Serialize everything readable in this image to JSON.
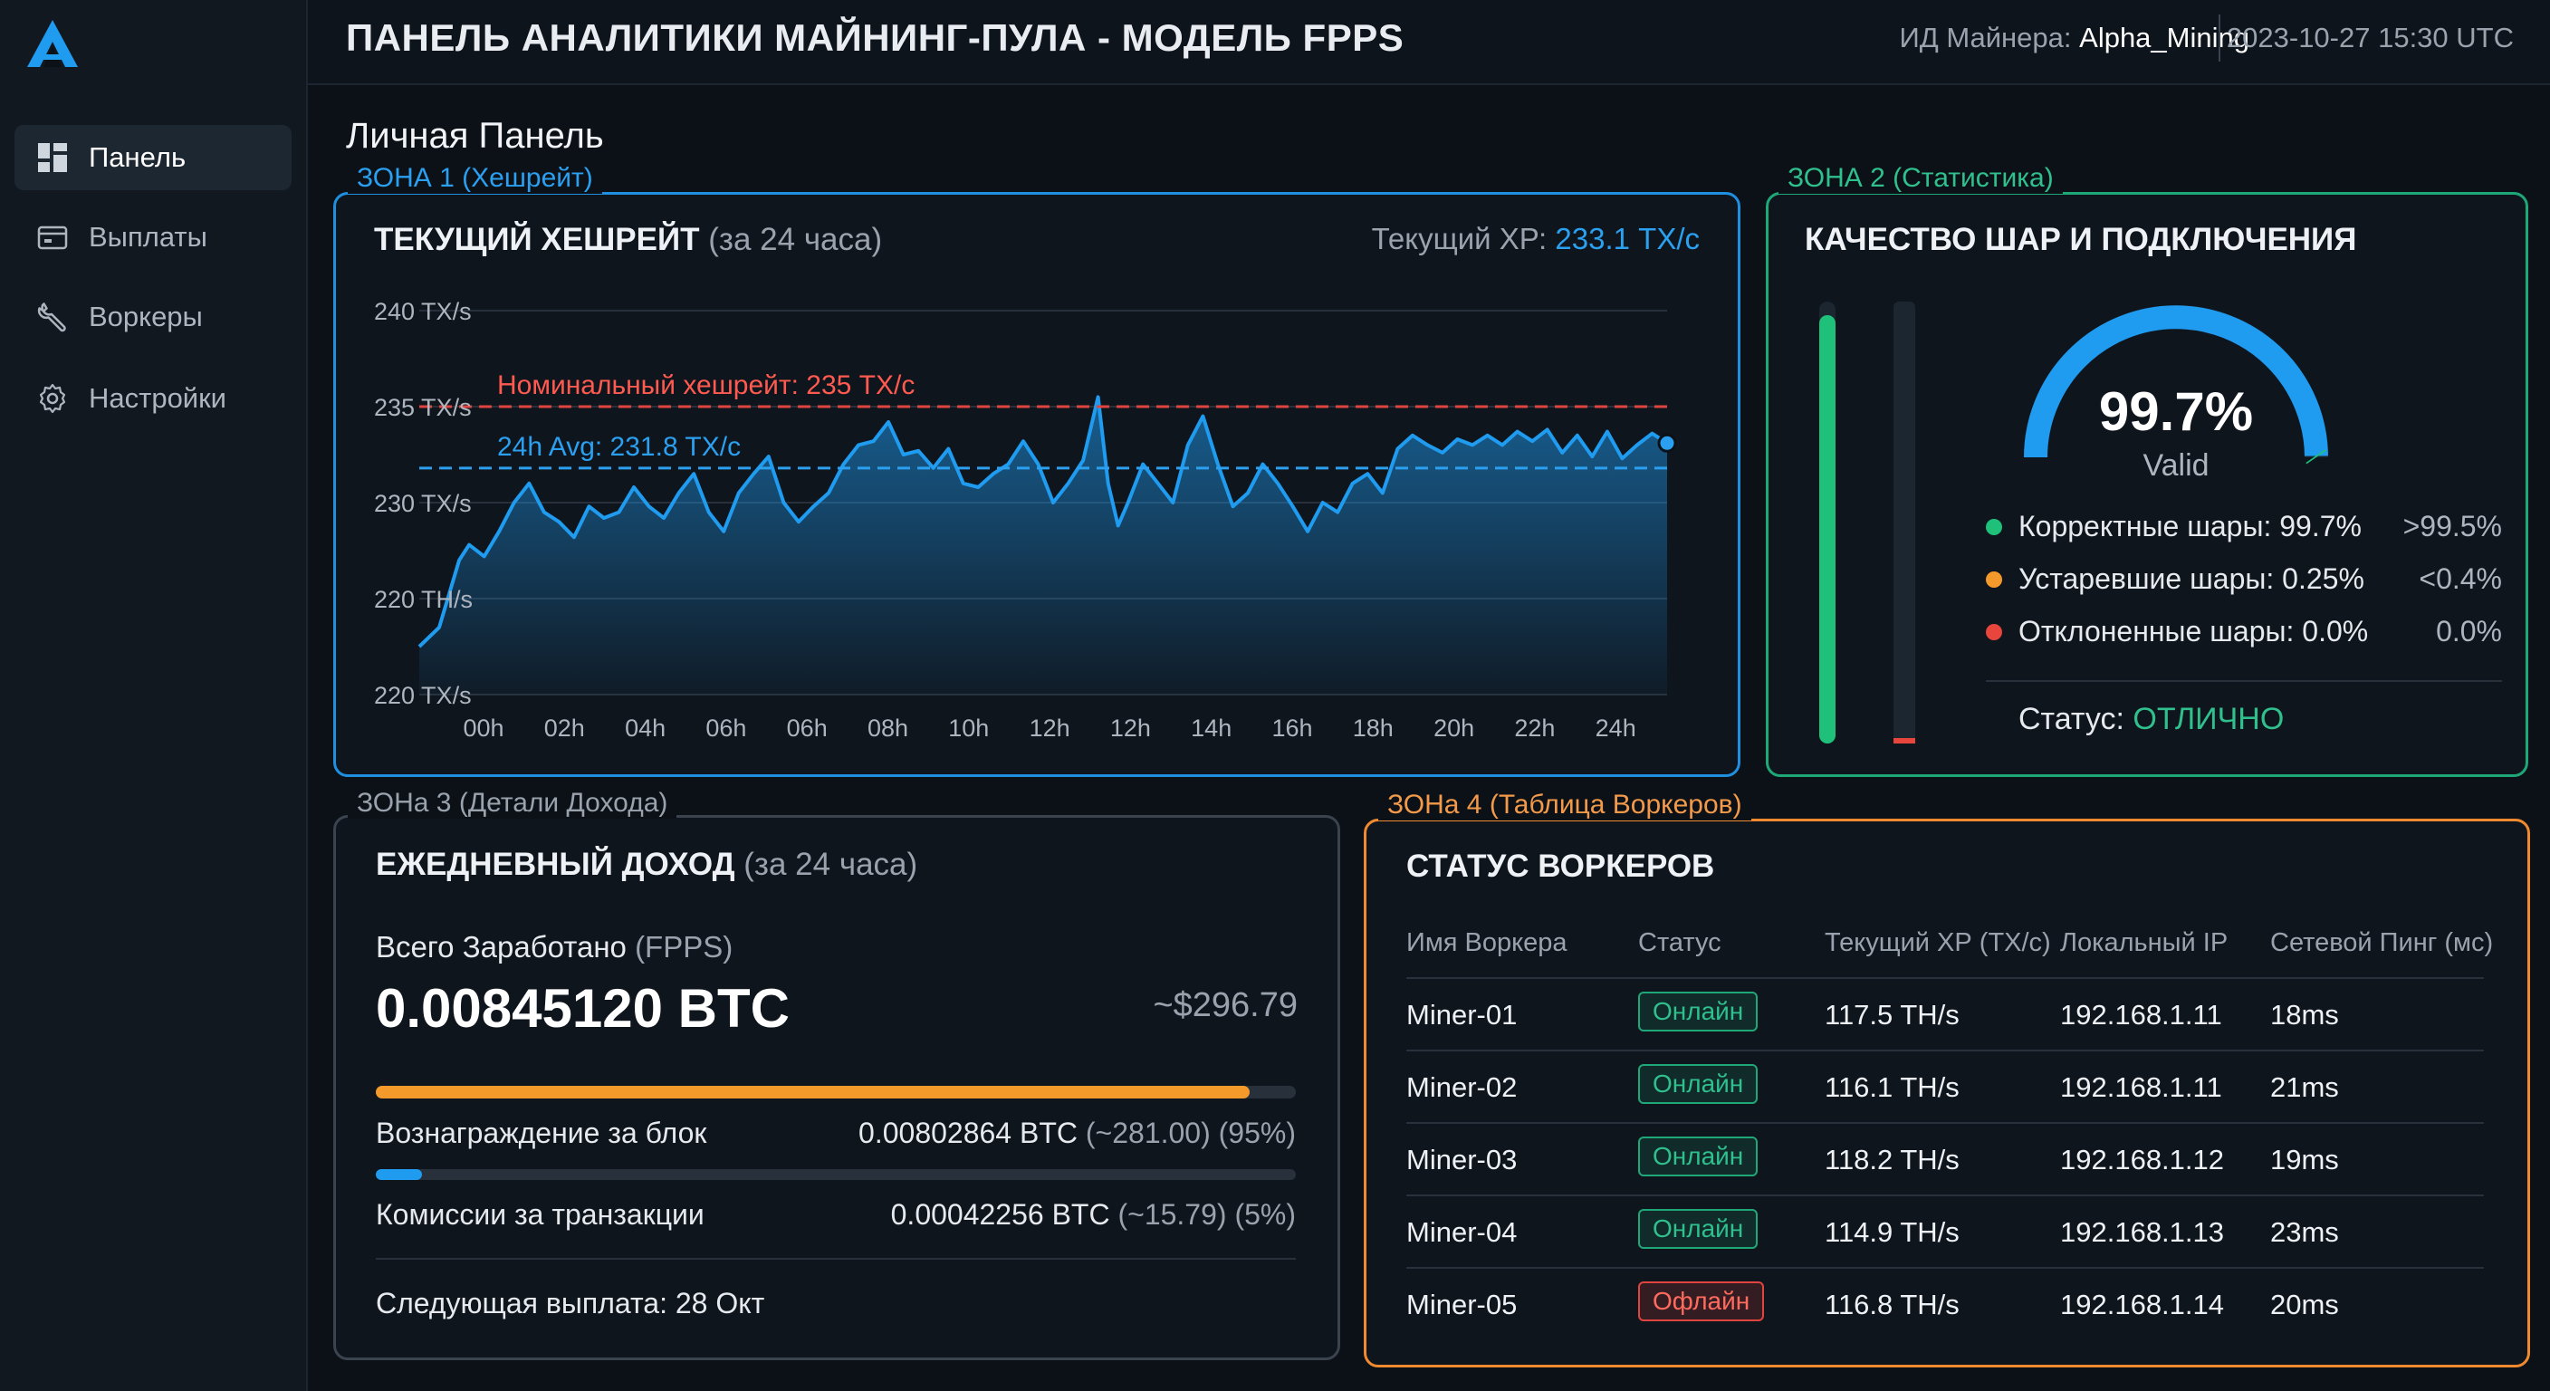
{
  "header": {
    "title": "ПАНЕЛЬ АНАЛИТИКИ МАЙНИНГ-ПУЛА - МОДЕЛЬ FPPS",
    "miner_id_label": "ИД Майнера:",
    "miner_id_value": "Alpha_Mining",
    "datetime": "2023-10-27 15:30 UTC"
  },
  "sidebar": {
    "items": [
      {
        "label": "Панель",
        "icon": "dashboard-icon",
        "active": true
      },
      {
        "label": "Выплаты",
        "icon": "wallet-icon",
        "active": false
      },
      {
        "label": "Воркеры",
        "icon": "wrench-icon",
        "active": false
      },
      {
        "label": "Настройки",
        "icon": "gear-icon",
        "active": false
      }
    ]
  },
  "page": {
    "section_title": "Личная Панель"
  },
  "zone1": {
    "tag": "ЗОНА 1 (Хешрейт)",
    "title": "ТЕКУЩИЙ ХЕШРЕЙТ",
    "title_note": "(за 24 часа)",
    "current_label": "Текущий ХР:",
    "current_value": "233.1 TX/c"
  },
  "chart_data": {
    "type": "area",
    "y_tick_labels": [
      "240 TX/s",
      "235 TX/s",
      "230 TX/s",
      "220 TH/s",
      "220 TX/s"
    ],
    "y_ticks": [
      240,
      235,
      230,
      225,
      220
    ],
    "ylim": [
      220,
      240
    ],
    "x_tick_labels": [
      "00h",
      "02h",
      "04h",
      "06h",
      "06h",
      "08h",
      "10h",
      "12h",
      "12h",
      "14h",
      "16h",
      "18h",
      "20h",
      "22h",
      "24h"
    ],
    "x_range": [
      0,
      25
    ],
    "nominal": {
      "label": "Номинальный хешрейт: 235 TX/c",
      "value": 235,
      "color": "#e0443e"
    },
    "average": {
      "label": "24h Avg: 231.8 TX/c",
      "value": 231.8,
      "color": "#2ba0f0"
    },
    "series": [
      {
        "color": "#1f9bf0",
        "x": [
          0,
          0.4,
          0.8,
          1.0,
          1.3,
          1.6,
          1.9,
          2.2,
          2.5,
          2.8,
          3.1,
          3.4,
          3.7,
          4.0,
          4.3,
          4.6,
          4.9,
          5.2,
          5.5,
          5.8,
          6.1,
          6.4,
          6.7,
          7.0,
          7.3,
          7.6,
          7.9,
          8.2,
          8.5,
          8.8,
          9.1,
          9.4,
          9.7,
          10.0,
          10.3,
          10.6,
          10.9,
          11.2,
          11.5,
          11.8,
          12.1,
          12.4,
          12.7,
          13.0,
          13.3,
          13.6,
          13.8,
          14.0,
          14.2,
          14.5,
          14.8,
          15.1,
          15.4,
          15.7,
          16.0,
          16.3,
          16.6,
          16.9,
          17.2,
          17.5,
          17.8,
          18.1,
          18.4,
          18.7,
          19.0,
          19.3,
          19.6,
          19.9,
          20.2,
          20.5,
          20.8,
          21.1,
          21.4,
          21.7,
          22.0,
          22.3,
          22.6,
          22.9,
          23.2,
          23.5,
          23.8,
          24.1,
          24.4,
          24.7,
          25.0
        ],
        "y": [
          222.5,
          223.5,
          227,
          227.8,
          227.2,
          228.5,
          230,
          231,
          229.5,
          229,
          228.2,
          229.8,
          229.2,
          229.5,
          230.8,
          229.8,
          229.2,
          230.5,
          231.5,
          229.5,
          228.5,
          230.5,
          231.5,
          232.4,
          230,
          229,
          229.8,
          230.5,
          232,
          233,
          233.2,
          234.2,
          232.5,
          232.7,
          231.8,
          232.8,
          231,
          230.8,
          231.5,
          232,
          233.2,
          232,
          230,
          231,
          232.2,
          235.5,
          231,
          228.8,
          230,
          232,
          231,
          230,
          233,
          234.5,
          232,
          229.8,
          230.5,
          232,
          231,
          229.8,
          228.5,
          230,
          229.5,
          231,
          231.5,
          230.5,
          232.8,
          233.5,
          233,
          232.6,
          233.3,
          233,
          233.5,
          233,
          233.7,
          233.2,
          233.8,
          232.6,
          233.5,
          232.4,
          233.7,
          232.3,
          233,
          233.6,
          233.1
        ]
      }
    ]
  },
  "zone2": {
    "tag": "ЗОНА 2 (Статистика)",
    "title": "КАЧЕСТВО ШАР И ПОДКЛЮЧЕНИЯ",
    "gauge_value": "99.7%",
    "gauge_fraction": 0.997,
    "gauge_label": "Valid",
    "left_bar_fraction": 0.97,
    "right_bar_fraction": 0.01,
    "legend": [
      {
        "label": "Корректные шары: 99.7%",
        "threshold": ">99.5%",
        "color": "#1fc07a"
      },
      {
        "label": "Устаревшие шары: 0.25%",
        "threshold": "<0.4%",
        "color": "#f39a2a"
      },
      {
        "label": "Отклоненные шары: 0.0%",
        "threshold": "0.0%",
        "color": "#e8453c"
      }
    ],
    "status_label": "Статус:",
    "status_value": "ОТЛИЧНО"
  },
  "zone3": {
    "tag": "ЗОНа 3 (Детали Дохода)",
    "title": "ЕЖЕДНЕВНЫЙ ДОХОД",
    "title_note": "(за 24 часа)",
    "earned_label": "Всего Заработано",
    "earned_note": "(FPPS)",
    "earned_value": "0.00845120 BTC",
    "earned_usd": "~$296.79",
    "block_reward_fraction": 0.95,
    "fees_fraction": 0.05,
    "block_reward_label": "Вознаграждение за блок",
    "block_reward_btc": "0.00802864 BTC",
    "block_reward_usd": "(~281.00)",
    "block_reward_pct": "(95%)",
    "fees_label": "Комиссии за транзакции",
    "fees_btc": "0.00042256 BTC",
    "fees_usd": "(~15.79)",
    "fees_pct": "(5%)",
    "next_payout": "Следующая выплата: 28 Окт"
  },
  "zone4": {
    "tag": "ЗОНа 4 (Таблица Воркеров)",
    "title": "СТАТУС ВОРКЕРОВ",
    "columns": [
      "Имя Воркера",
      "Статус",
      "Текущий ХР (TX/c)",
      "Локальный IP",
      "Сетевой Пинг (мс)"
    ],
    "rows": [
      {
        "name": "Miner-01",
        "status": "Онлайн",
        "online": true,
        "hashrate": "117.5 TH/s",
        "ip": "192.168.1.11",
        "ping": "18ms"
      },
      {
        "name": "Miner-02",
        "status": "Онлайн",
        "online": true,
        "hashrate": "116.1 TH/s",
        "ip": "192.168.1.11",
        "ping": "21ms"
      },
      {
        "name": "Miner-03",
        "status": "Онлайн",
        "online": true,
        "hashrate": "118.2 TH/s",
        "ip": "192.168.1.12",
        "ping": "19ms"
      },
      {
        "name": "Miner-04",
        "status": "Онлайн",
        "online": true,
        "hashrate": "114.9 TH/s",
        "ip": "192.168.1.13",
        "ping": "23ms"
      },
      {
        "name": "Miner-05",
        "status": "Офлайн",
        "online": false,
        "hashrate": "116.8 TH/s",
        "ip": "192.168.1.14",
        "ping": "20ms"
      }
    ]
  },
  "colors": {
    "accent_blue": "#1f9bf0",
    "accent_green": "#1fc07a",
    "accent_orange": "#f08a30",
    "danger_red": "#e0443e"
  }
}
